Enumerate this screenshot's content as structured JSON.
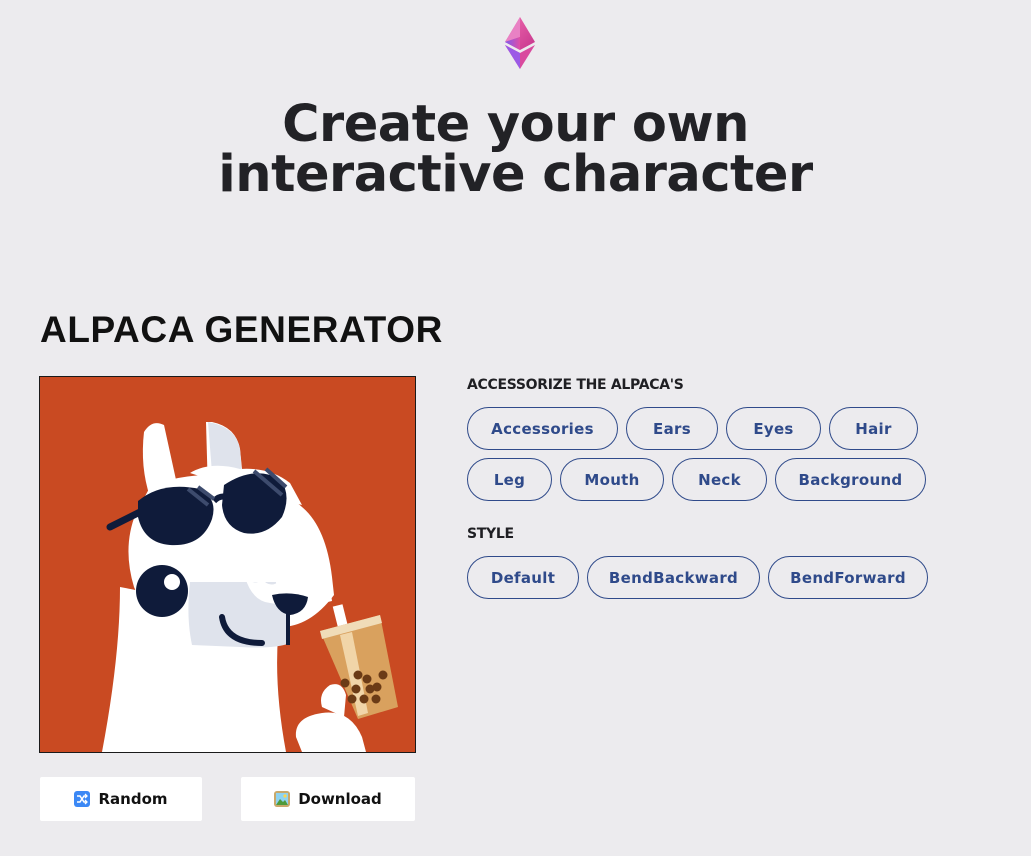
{
  "hero": {
    "title_line1": "Create your own",
    "title_line2": "interactive character"
  },
  "generator": {
    "title": "ALPACA GENERATOR",
    "background_color": "#c94a22"
  },
  "actions": {
    "random_label": "Random",
    "random_icon": "shuffle-icon",
    "download_label": "Download",
    "download_icon": "picture-icon"
  },
  "accessorize": {
    "label": "ACCESSORIZE THE ALPACA'S",
    "options": [
      "Accessories",
      "Ears",
      "Eyes",
      "Hair",
      "Leg",
      "Mouth",
      "Neck",
      "Background"
    ]
  },
  "style": {
    "label": "STYLE",
    "options": [
      "Default",
      "BendBackward",
      "BendForward"
    ]
  },
  "colors": {
    "page_bg": "#ecebee",
    "pill_border": "#2f4a8a",
    "logo_pink": "#e14fa3",
    "logo_purple": "#8b5cf6"
  }
}
